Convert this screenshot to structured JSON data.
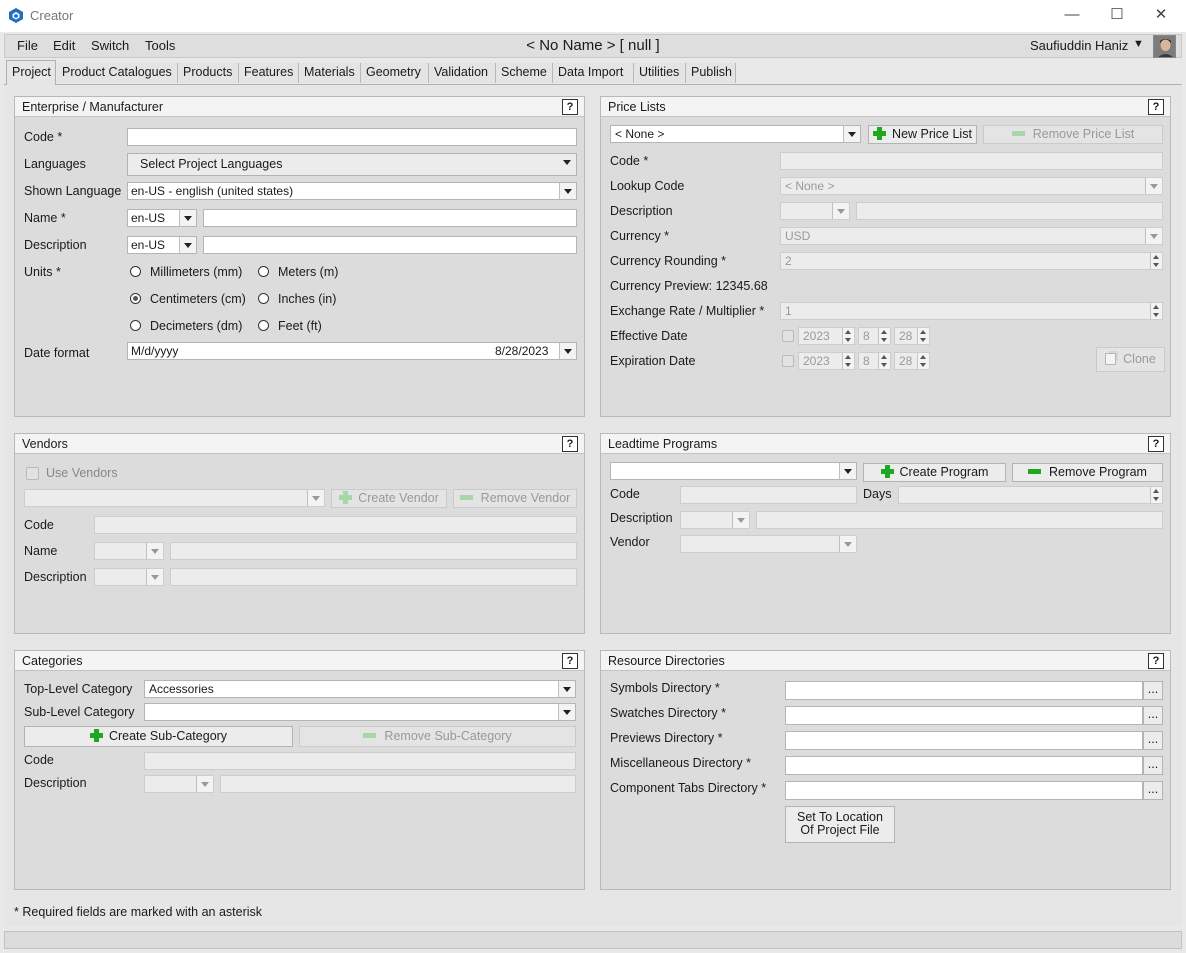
{
  "window": {
    "title": "Creator",
    "document_title": "< No Name > [ null ]",
    "user": "Saufiuddin Haniz"
  },
  "menu": [
    "File",
    "Edit",
    "Switch",
    "Tools"
  ],
  "tabs": [
    "Project",
    "Product Catalogues",
    "Products",
    "Features",
    "Materials",
    "Geometry",
    "Validation",
    "Scheme",
    "Data Import",
    "Utilities",
    "Publish"
  ],
  "enterprise": {
    "title": "Enterprise / Manufacturer",
    "code_label": "Code *",
    "languages_label": "Languages",
    "languages_button": "Select Project Languages",
    "shown_language_label": "Shown Language",
    "shown_language_value": "en-US - english (united states)",
    "name_label": "Name *",
    "name_lang": "en-US",
    "description_label": "Description",
    "description_lang": "en-US",
    "units_label": "Units *",
    "units": [
      "Millimeters (mm)",
      "Meters (m)",
      "Centimeters (cm)",
      "Inches (in)",
      "Decimeters (dm)",
      "Feet (ft)"
    ],
    "selected_unit": "Centimeters (cm)",
    "date_format_label": "Date format",
    "date_format_value": "M/d/yyyy",
    "date_preview": "8/28/2023"
  },
  "price_lists": {
    "title": "Price Lists",
    "selector": "< None >",
    "new_button": "New Price List",
    "remove_button": "Remove Price List",
    "code_label": "Code *",
    "lookup_label": "Lookup Code",
    "lookup_value": "< None >",
    "description_label": "Description",
    "currency_label": "Currency *",
    "currency_value": "USD",
    "rounding_label": "Currency Rounding *",
    "rounding_value": "2",
    "preview_text": "Currency Preview: 12345.68",
    "exchange_label": "Exchange Rate / Multiplier *",
    "exchange_value": "1",
    "effective_label": "Effective Date",
    "expiration_label": "Expiration Date",
    "date_year": "2023",
    "date_month": "8",
    "date_day": "28",
    "clone_button": "Clone"
  },
  "vendors": {
    "title": "Vendors",
    "use_label": "Use Vendors",
    "create_button": "Create Vendor",
    "remove_button": "Remove Vendor",
    "code_label": "Code",
    "name_label": "Name",
    "description_label": "Description"
  },
  "leadtime": {
    "title": "Leadtime Programs",
    "create_button": "Create Program",
    "remove_button": "Remove Program",
    "code_label": "Code",
    "days_label": "Days",
    "description_label": "Description",
    "vendor_label": "Vendor"
  },
  "categories": {
    "title": "Categories",
    "top_label": "Top-Level Category",
    "top_value": "Accessories",
    "sub_label": "Sub-Level Category",
    "create_button": "Create Sub-Category",
    "remove_button": "Remove Sub-Category",
    "code_label": "Code",
    "description_label": "Description"
  },
  "resources": {
    "title": "Resource Directories",
    "rows": [
      "Symbols Directory *",
      "Swatches Directory *",
      "Previews Directory *",
      "Miscellaneous Directory *",
      "Component Tabs Directory *"
    ],
    "browse": "...",
    "set_button_line1": "Set To Location",
    "set_button_line2": "Of Project File"
  },
  "help": "?",
  "footer_note": "* Required fields are marked with an asterisk",
  "colors": {
    "accent": "#1fa81f",
    "app_icon": "#1d6fbf"
  }
}
